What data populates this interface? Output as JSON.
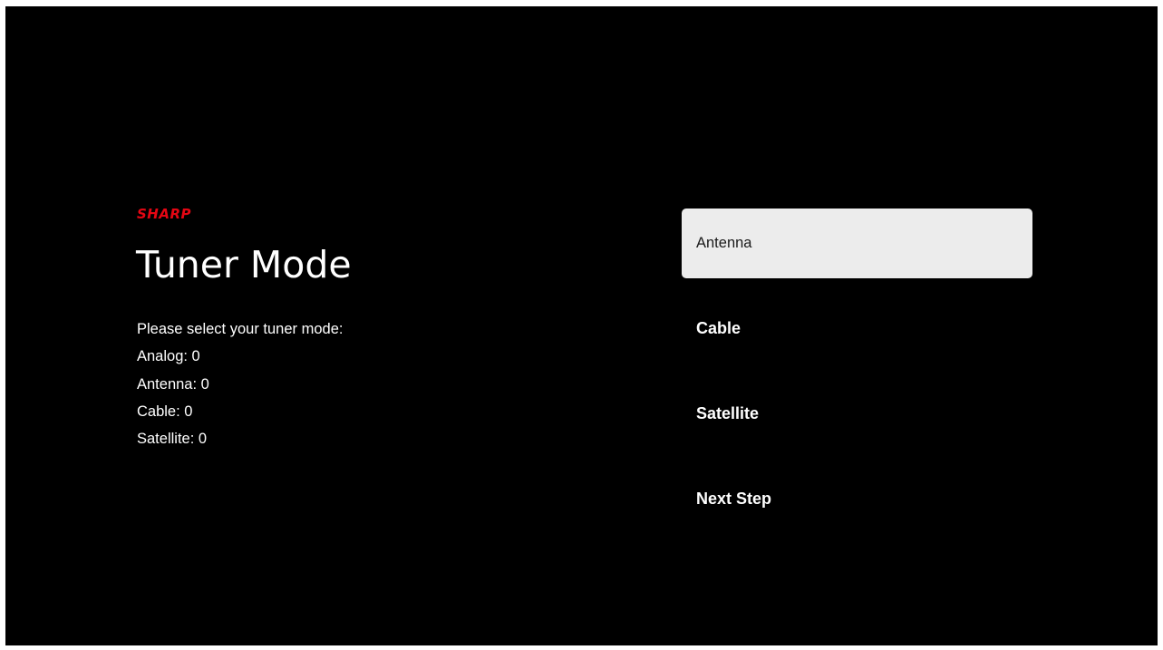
{
  "brand": {
    "logo_text": "SHARP",
    "logo_color": "#e30613"
  },
  "page": {
    "title": "Tuner Mode",
    "description_lines": [
      "Please select your tuner mode:",
      "Analog: 0",
      "Antenna: 0",
      "Cable: 0",
      "Satellite: 0"
    ]
  },
  "menu": {
    "selected_index": 0,
    "items": [
      {
        "label": "Antenna",
        "selected": true
      },
      {
        "label": "Cable",
        "selected": false
      },
      {
        "label": "Satellite",
        "selected": false
      },
      {
        "label": "Next Step",
        "selected": false
      }
    ]
  },
  "colors": {
    "background": "#000000",
    "selected_item_background": "#ececec",
    "selected_item_text": "#1a1a1a",
    "text": "#ffffff"
  }
}
